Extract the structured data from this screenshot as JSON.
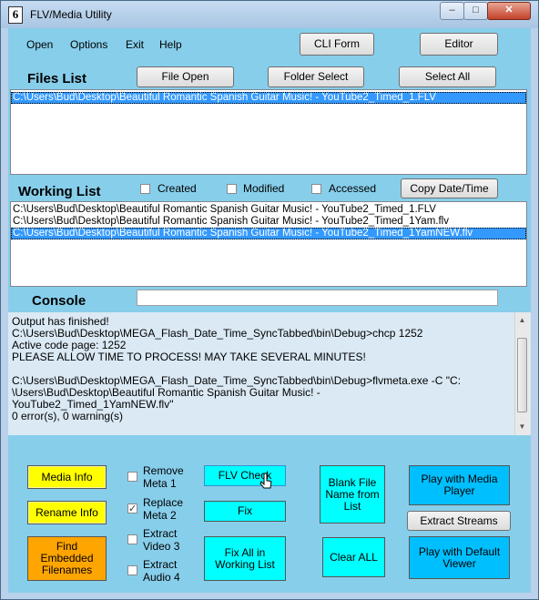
{
  "window": {
    "title": "FLV/Media Utility",
    "app_icon": "6",
    "min_glyph": "–",
    "max_glyph": "□",
    "close_glyph": "✕"
  },
  "menu": {
    "items": [
      "Open",
      "Options",
      "Exit",
      "Help"
    ],
    "cli_form": "CLI Form",
    "editor": "Editor"
  },
  "files": {
    "label": "Files List",
    "file_open": "File Open",
    "folder_select": "Folder Select",
    "select_all": "Select All",
    "rows": [
      "C:\\Users\\Bud\\Desktop\\Beautiful Romantic Spanish Guitar Music! - YouTube2_Timed_1.FLV"
    ]
  },
  "working": {
    "label": "Working List",
    "created": "Created",
    "modified": "Modified",
    "accessed": "Accessed",
    "copy_date_time": "Copy Date/Time",
    "rows": [
      "C:\\Users\\Bud\\Desktop\\Beautiful Romantic Spanish Guitar Music! - YouTube2_Timed_1.FLV",
      "C:\\Users\\Bud\\Desktop\\Beautiful Romantic Spanish Guitar Music! - YouTube2_Timed_1Yam.flv",
      "C:\\Users\\Bud\\Desktop\\Beautiful Romantic Spanish Guitar Music! - YouTube2_Timed_1YamNEW.flv"
    ]
  },
  "console": {
    "label": "Console",
    "input_value": "",
    "lines": [
      " Output has finished!",
      "C:\\Users\\Bud\\Desktop\\MEGA_Flash_Date_Time_SyncTabbed\\bin\\Debug>chcp 1252",
      "Active code page: 1252",
      "PLEASE ALLOW TIME TO PROCESS!  MAY TAKE SEVERAL MINUTES!",
      "",
      "C:\\Users\\Bud\\Desktop\\MEGA_Flash_Date_Time_SyncTabbed\\bin\\Debug>flvmeta.exe -C \"C:",
      "\\Users\\Bud\\Desktop\\Beautiful Romantic Spanish Guitar Music! -",
      "YouTube2_Timed_1YamNEW.flv\"",
      "0 error(s), 0 warning(s)"
    ]
  },
  "actions": {
    "media_info": "Media Info",
    "rename_info": "Rename Info",
    "find_embedded": [
      "Find",
      "Embedded",
      "Filenames"
    ],
    "remove_meta": [
      "Remove",
      "Meta  1"
    ],
    "replace_meta": [
      "Replace",
      "Meta  2"
    ],
    "extract_video": [
      "Extract",
      "Video 3"
    ],
    "extract_audio": [
      "Extract",
      "Audio 4"
    ],
    "replace_meta_checked": true,
    "flv_check": "FLV Check",
    "fix": "Fix",
    "fix_all": [
      "Fix All in",
      "Working List"
    ],
    "blank_file_name": [
      "Blank File",
      "Name from",
      "List"
    ],
    "clear_all": "Clear ALL",
    "play_media_player": [
      "Play with Media",
      "Player"
    ],
    "extract_streams": "Extract Streams",
    "play_default_viewer": [
      "Play with Default",
      "Viewer"
    ],
    "check_mark": "✓"
  },
  "colors": {
    "panel": "#87ceeb",
    "yellow": "#ffff00",
    "orange": "#ffa500",
    "cyan": "#00ffff",
    "deep_sky": "#00bfff",
    "selection": "#3399ff"
  }
}
